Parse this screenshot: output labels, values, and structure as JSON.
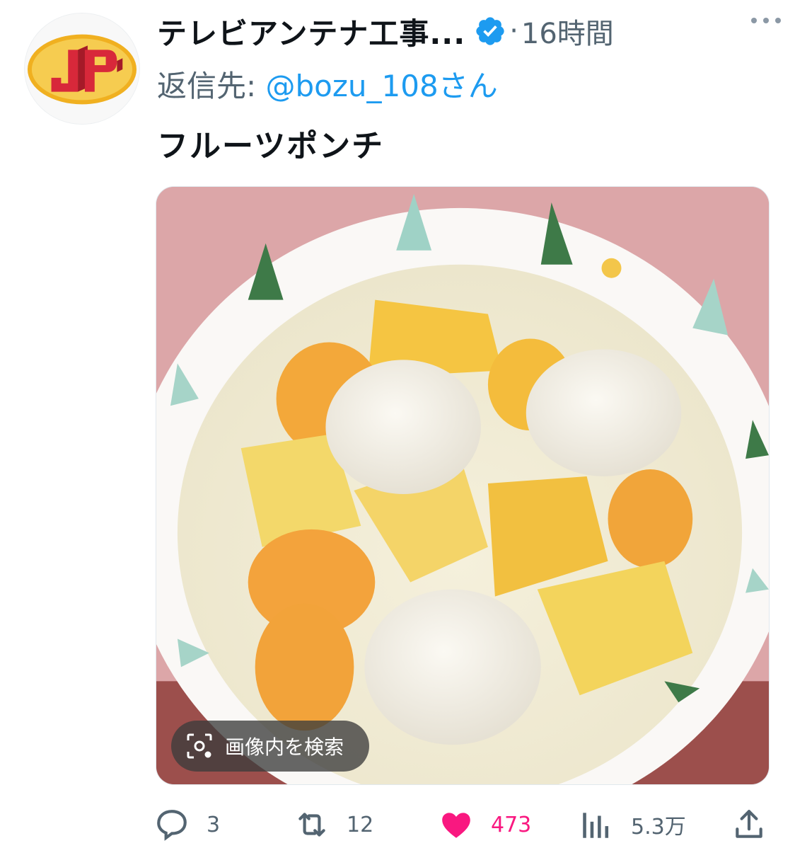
{
  "tweet": {
    "display_name": "テレビアンテナ工事...",
    "verified": true,
    "separator": "·",
    "time": "16時間",
    "reply_prefix": "返信先: ",
    "reply_handle": "@bozu_108さん",
    "text": "フルーツポンチ",
    "avatar_icon": "jp-logo-icon"
  },
  "media": {
    "lens_label": "画像内を検索",
    "lens_icon": "image-search-icon"
  },
  "actions": {
    "replies": "3",
    "retweets": "12",
    "likes": "473",
    "views": "5.3万",
    "reply_icon": "reply-icon",
    "retweet_icon": "retweet-icon",
    "like_icon": "heart-icon",
    "views_icon": "analytics-icon",
    "share_icon": "share-icon"
  },
  "colors": {
    "link": "#1d9bf0",
    "muted": "#536471",
    "like": "#f91880",
    "verified": "#1d9bf0"
  }
}
